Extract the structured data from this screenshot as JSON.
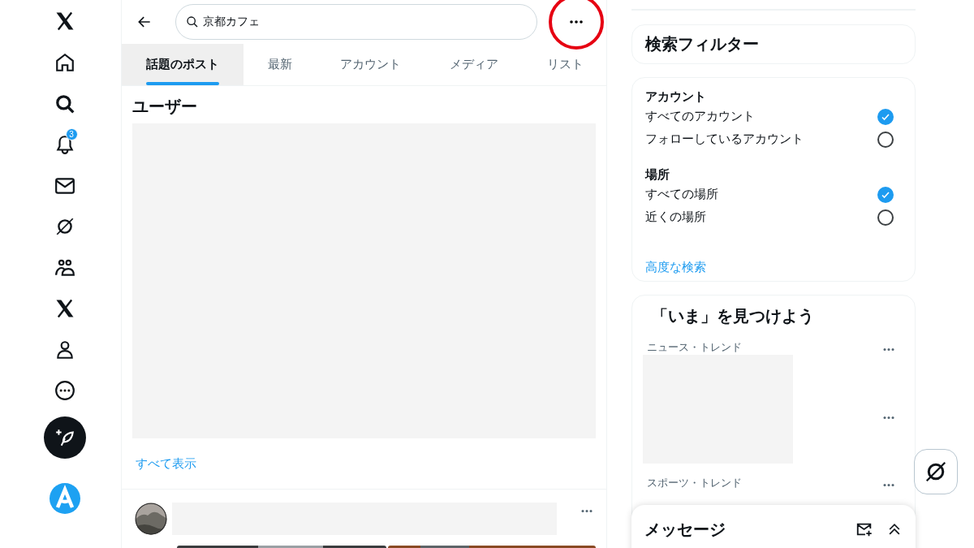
{
  "nav": [
    {
      "kind": "logo"
    },
    {
      "kind": "home"
    },
    {
      "kind": "search"
    },
    {
      "kind": "bell",
      "badge": "3"
    },
    {
      "kind": "mail"
    },
    {
      "kind": "grok"
    },
    {
      "kind": "people"
    },
    {
      "kind": "logo"
    },
    {
      "kind": "person"
    },
    {
      "kind": "more"
    },
    {
      "kind": "compose"
    },
    {
      "kind": "account"
    }
  ],
  "search": {
    "value": "京都カフェ"
  },
  "more_button": {
    "highlighted": true
  },
  "tabs": [
    {
      "label": "話題のポスト",
      "selected": true
    },
    {
      "label": "最新",
      "selected": false
    },
    {
      "label": "アカウント",
      "selected": false
    },
    {
      "label": "メディア",
      "selected": false
    },
    {
      "label": "リスト",
      "selected": false
    }
  ],
  "users": {
    "title": "ユーザー",
    "show_all": "すべて表示"
  },
  "filters": {
    "title": "検索フィルター",
    "groups": [
      {
        "title": "アカウント",
        "options": [
          {
            "label": "すべてのアカウント",
            "checked": true
          },
          {
            "label": "フォローしているアカウント",
            "checked": false
          }
        ]
      },
      {
        "title": "場所",
        "options": [
          {
            "label": "すべての場所",
            "checked": true
          },
          {
            "label": "近くの場所",
            "checked": false
          }
        ]
      }
    ],
    "advanced": "高度な検索"
  },
  "trends": {
    "title": "「いま」を見つけよう",
    "items": [
      {
        "category": "ニュース・トレンド"
      },
      {
        "category": "スポーツ・トレンド"
      }
    ]
  },
  "messages": {
    "title": "メッセージ"
  }
}
